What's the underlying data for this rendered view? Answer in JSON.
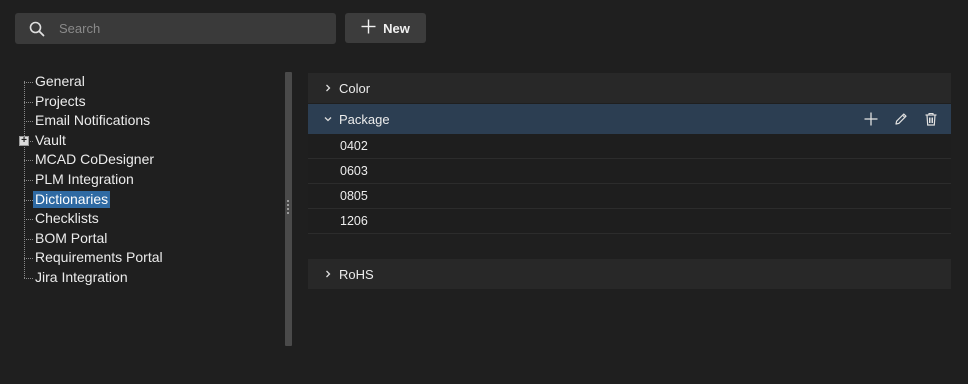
{
  "search": {
    "placeholder": "Search",
    "icon": "search-icon"
  },
  "toolbar": {
    "new_label": "New",
    "new_icon": "plus-icon"
  },
  "tree": {
    "items": [
      {
        "label": "General"
      },
      {
        "label": "Projects"
      },
      {
        "label": "Email Notifications"
      },
      {
        "label": "Vault",
        "expander": "+"
      },
      {
        "label": "MCAD CoDesigner"
      },
      {
        "label": "PLM Integration"
      },
      {
        "label": "Dictionaries",
        "selected": true
      },
      {
        "label": "Checklists"
      },
      {
        "label": "BOM Portal"
      },
      {
        "label": "Requirements Portal"
      },
      {
        "label": "Jira Integration"
      }
    ]
  },
  "dictionaries": [
    {
      "name": "Color",
      "expanded": false
    },
    {
      "name": "Package",
      "expanded": true,
      "values": [
        "0402",
        "0603",
        "0805",
        "1206"
      ]
    },
    {
      "name": "RoHS",
      "expanded": false
    }
  ],
  "colors": {
    "background": "#1f1f1f",
    "selection": "#2f6aa3",
    "expanded_header": "#2c3e52"
  }
}
